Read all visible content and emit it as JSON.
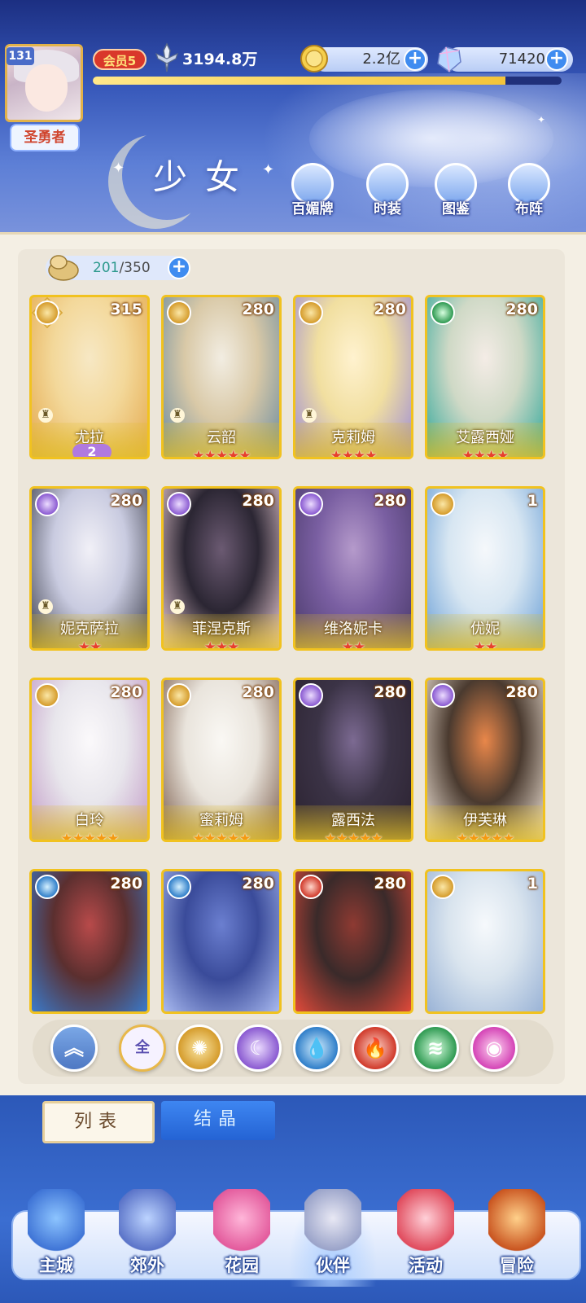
{
  "header": {
    "player_level": "131",
    "player_title": "圣勇者",
    "vip": "会员5",
    "power": "3194.8万",
    "exp_progress": 0.88,
    "gold": "2.2亿",
    "gems": "71420",
    "page_title": "少女",
    "buttons": [
      {
        "label": "百媚牌",
        "icon": "card-deck-icon"
      },
      {
        "label": "时装",
        "icon": "costume-icon"
      },
      {
        "label": "图鉴",
        "icon": "book-icon"
      },
      {
        "label": "布阵",
        "icon": "grid-formation-icon"
      }
    ]
  },
  "capacity": {
    "current": "201",
    "max": "/350"
  },
  "cards": [
    {
      "name": "尤拉",
      "level": "315",
      "element": "sun",
      "stars": 0,
      "star_color": "",
      "wing_badge": "2",
      "chess": true
    },
    {
      "name": "云韶",
      "level": "280",
      "element": "sun",
      "stars": 5,
      "star_color": "red",
      "chess": true
    },
    {
      "name": "克莉姆",
      "level": "280",
      "element": "sun",
      "stars": 4,
      "star_color": "red",
      "chess": true
    },
    {
      "name": "艾露西娅",
      "level": "280",
      "element": "wind",
      "stars": 4,
      "star_color": "red",
      "chess": false
    },
    {
      "name": "妮克萨拉",
      "level": "280",
      "element": "moon",
      "stars": 2,
      "star_color": "red",
      "chess": true
    },
    {
      "name": "菲涅克斯",
      "level": "280",
      "element": "moon",
      "stars": 3,
      "star_color": "red",
      "chess": true
    },
    {
      "name": "维洛妮卡",
      "level": "280",
      "element": "moon",
      "stars": 2,
      "star_color": "red",
      "chess": false
    },
    {
      "name": "优妮",
      "level": "1",
      "element": "sun",
      "stars": 2,
      "star_color": "red",
      "chess": false
    },
    {
      "name": "白玲",
      "level": "280",
      "element": "sun",
      "stars": 5,
      "star_color": "gold",
      "chess": false
    },
    {
      "name": "蜜莉姆",
      "level": "280",
      "element": "sun",
      "stars": 5,
      "star_color": "gold",
      "chess": false
    },
    {
      "name": "露西法",
      "level": "280",
      "element": "moon",
      "stars": 5,
      "star_color": "gold",
      "chess": false
    },
    {
      "name": "伊芙琳",
      "level": "280",
      "element": "moon",
      "stars": 5,
      "star_color": "gold",
      "chess": false
    },
    {
      "name": "",
      "level": "280",
      "element": "water",
      "stars": 0,
      "star_color": "",
      "chess": false
    },
    {
      "name": "",
      "level": "280",
      "element": "water",
      "stars": 0,
      "star_color": "",
      "chess": false
    },
    {
      "name": "",
      "level": "280",
      "element": "fire",
      "stars": 0,
      "star_color": "",
      "chess": false
    },
    {
      "name": "",
      "level": "1",
      "element": "sun",
      "stars": 0,
      "star_color": "",
      "chess": false
    }
  ],
  "filters": [
    {
      "icon": "collapse-icon"
    },
    {
      "label": "全",
      "icon": "all-filter-icon"
    },
    {
      "icon": "sun-element-icon"
    },
    {
      "icon": "moon-element-icon"
    },
    {
      "icon": "water-element-icon"
    },
    {
      "icon": "fire-element-icon"
    },
    {
      "icon": "wind-element-icon"
    },
    {
      "icon": "pink-element-icon"
    }
  ],
  "tabs": {
    "list": "列表",
    "crystal": "结晶"
  },
  "nav": [
    {
      "label": "主城",
      "icon": "castle-icon"
    },
    {
      "label": "郊外",
      "icon": "portal-icon"
    },
    {
      "label": "花园",
      "icon": "heart-garden-icon"
    },
    {
      "label": "伙伴",
      "icon": "partner-icon"
    },
    {
      "label": "活动",
      "icon": "gift-box-icon"
    },
    {
      "label": "冒险",
      "icon": "compass-icon"
    }
  ],
  "colors": {
    "accent_blue": "#3f8cf0",
    "card_gold": "#f1c21f",
    "header_dark": "#1c2f82"
  }
}
